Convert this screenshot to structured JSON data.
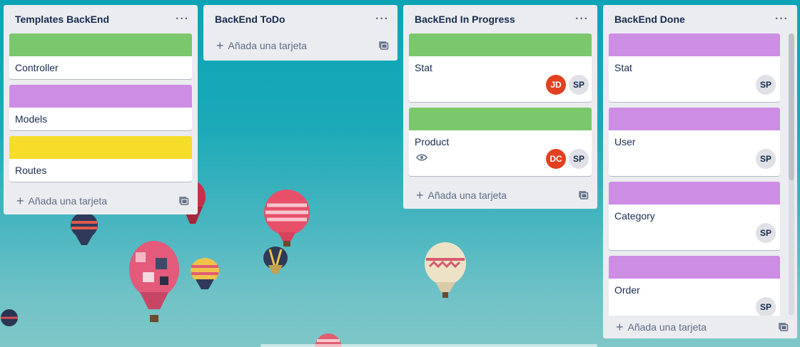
{
  "colors": {
    "green": "#7bc86c",
    "purple": "#cd8de5",
    "yellow": "#f5dd29",
    "avatar_red": "#e2411f"
  },
  "lists": [
    {
      "title": "Templates BackEnd",
      "menu": "···",
      "add_label": "Añada una tarjeta",
      "cards": [
        {
          "label": "Controller",
          "cover": "green"
        },
        {
          "label": "Models",
          "cover": "purple"
        },
        {
          "label": "Routes",
          "cover": "yellow"
        }
      ]
    },
    {
      "title": "BackEnd ToDo",
      "menu": "···",
      "add_label": "Añada una tarjeta",
      "cards": []
    },
    {
      "title": "BackEnd In Progress",
      "menu": "···",
      "add_label": "Añada una tarjeta",
      "cards": [
        {
          "label": "Stat",
          "cover": "green",
          "members": [
            "JD",
            "SP"
          ]
        },
        {
          "label": "Product",
          "cover": "green",
          "members": [
            "DC",
            "SP"
          ],
          "watching": true
        }
      ]
    },
    {
      "title": "BackEnd Done",
      "menu": "···",
      "add_label": "Añada una tarjeta",
      "cards": [
        {
          "label": "Stat",
          "cover": "purple",
          "members": [
            "SP"
          ]
        },
        {
          "label": "User",
          "cover": "purple",
          "members": [
            "SP"
          ]
        },
        {
          "label": "Category",
          "cover": "purple",
          "members": [
            "SP"
          ]
        },
        {
          "label": "Order",
          "cover": "purple",
          "members": [
            "SP"
          ]
        }
      ]
    }
  ]
}
